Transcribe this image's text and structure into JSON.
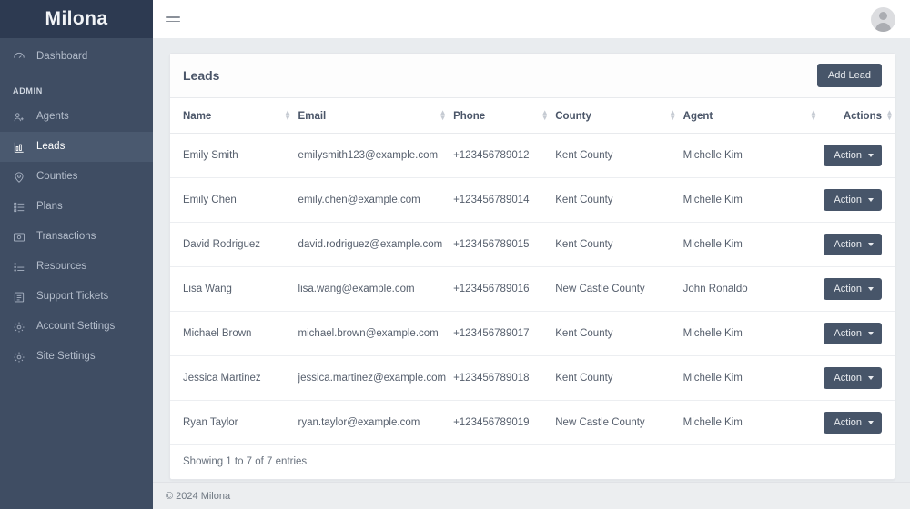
{
  "brand": {
    "name": "Milona"
  },
  "sidebar": {
    "top_items": [
      {
        "label": "Dashboard",
        "icon": "gauge-icon",
        "active": false
      }
    ],
    "section_label": "ADMIN",
    "items": [
      {
        "label": "Agents",
        "icon": "user-plus-icon",
        "active": false
      },
      {
        "label": "Leads",
        "icon": "bar-chart-icon",
        "active": true
      },
      {
        "label": "Counties",
        "icon": "map-pin-icon",
        "active": false
      },
      {
        "label": "Plans",
        "icon": "list-checks-icon",
        "active": false
      },
      {
        "label": "Transactions",
        "icon": "transaction-icon",
        "active": false
      },
      {
        "label": "Resources",
        "icon": "list-icon",
        "active": false
      },
      {
        "label": "Support Tickets",
        "icon": "document-icon",
        "active": false
      },
      {
        "label": "Account Settings",
        "icon": "gear-icon",
        "active": false
      },
      {
        "label": "Site Settings",
        "icon": "gear-icon",
        "active": false
      }
    ]
  },
  "topbar": {
    "menu_toggle": "hamburger-icon",
    "avatar": "user-avatar-icon"
  },
  "card": {
    "title": "Leads",
    "add_button": "Add Lead",
    "footer_text": "Showing 1 to 7 of 7 entries"
  },
  "table": {
    "columns": [
      "Name",
      "Email",
      "Phone",
      "County",
      "Agent",
      "Actions"
    ],
    "action_label": "Action",
    "rows": [
      {
        "name": "Emily Smith",
        "email": "emilysmith123@example.com",
        "phone": "+123456789012",
        "county": "Kent County",
        "agent": "Michelle Kim"
      },
      {
        "name": "Emily Chen",
        "email": "emily.chen@example.com",
        "phone": "+123456789014",
        "county": "Kent County",
        "agent": "Michelle Kim"
      },
      {
        "name": "David Rodriguez",
        "email": "david.rodriguez@example.com",
        "phone": "+123456789015",
        "county": "Kent County",
        "agent": "Michelle Kim"
      },
      {
        "name": "Lisa Wang",
        "email": "lisa.wang@example.com",
        "phone": "+123456789016",
        "county": "New Castle County",
        "agent": "John Ronaldo"
      },
      {
        "name": "Michael Brown",
        "email": "michael.brown@example.com",
        "phone": "+123456789017",
        "county": "Kent County",
        "agent": "Michelle Kim"
      },
      {
        "name": "Jessica Martinez",
        "email": "jessica.martinez@example.com",
        "phone": "+123456789018",
        "county": "Kent County",
        "agent": "Michelle Kim"
      },
      {
        "name": "Ryan Taylor",
        "email": "ryan.taylor@example.com",
        "phone": "+123456789019",
        "county": "New Castle County",
        "agent": "Michelle Kim"
      }
    ]
  },
  "footer": {
    "copyright": "© 2024 Milona"
  },
  "colors": {
    "sidebar_bg": "#3f4d63",
    "sidebar_brand_bg": "#2d3a51",
    "sidebar_active_bg": "#4a596f",
    "accent_button": "#475569",
    "page_bg": "#e9ecef"
  }
}
